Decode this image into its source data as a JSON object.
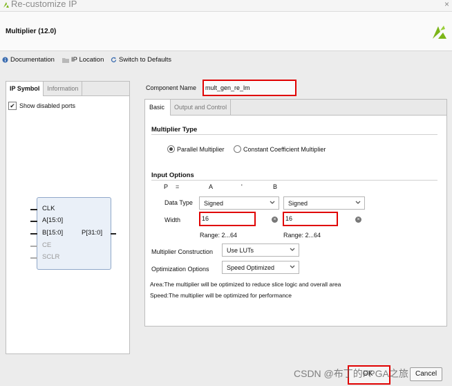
{
  "window": {
    "title": "Re-customize IP",
    "close_glyph": "×"
  },
  "header": {
    "title": "Multiplier (12.0)"
  },
  "toolbar": {
    "documentation": "Documentation",
    "ip_location": "IP Location",
    "switch_defaults": "Switch to Defaults"
  },
  "left_panel": {
    "tabs": [
      "IP Symbol",
      "Information"
    ],
    "show_disabled": {
      "label": "Show disabled ports",
      "checked": true
    },
    "ports": {
      "clk": "CLK",
      "a": "A[15:0]",
      "b": "B[15:0]",
      "ce": "CE",
      "sclr": "SCLR",
      "p": "P[31:0]"
    }
  },
  "component": {
    "label": "Component Name",
    "value": "mult_gen_re_lm"
  },
  "right_panel": {
    "tabs": [
      "Basic",
      "Output and Control"
    ],
    "multiplier_type": {
      "title": "Multiplier Type",
      "options": [
        "Parallel Multiplier",
        "Constant Coefficient Multiplier"
      ],
      "selected": "Parallel Multiplier"
    },
    "input_options": {
      "title": "Input Options",
      "eq_p": "P",
      "eq_equals": "=",
      "eq_a": "A",
      "eq_op": "'",
      "eq_b": "B",
      "data_type_label": "Data Type",
      "data_type_a": "Signed",
      "data_type_b": "Signed",
      "width_label": "Width",
      "width_a": "16",
      "width_b": "16",
      "range_a": "Range: 2...64",
      "range_b": "Range: 2...64"
    },
    "construction": {
      "label": "Multiplier Construction",
      "value": "Use LUTs"
    },
    "optimization": {
      "label": "Optimization Options",
      "value": "Speed Optimized"
    },
    "notes": [
      "Area:The multiplier will be optimized to reduce slice logic and overall area",
      "Speed:The multiplier will be optimized for performance"
    ]
  },
  "buttons": {
    "ok": "OK",
    "cancel": "Cancel"
  },
  "watermark": "CSDN @布丁的FPGA之旅",
  "colors": {
    "highlight": "#e00000",
    "ip_box_fill": "#eaf0f8",
    "ip_box_border": "#8fa7c9",
    "logo": "#7cb518"
  }
}
